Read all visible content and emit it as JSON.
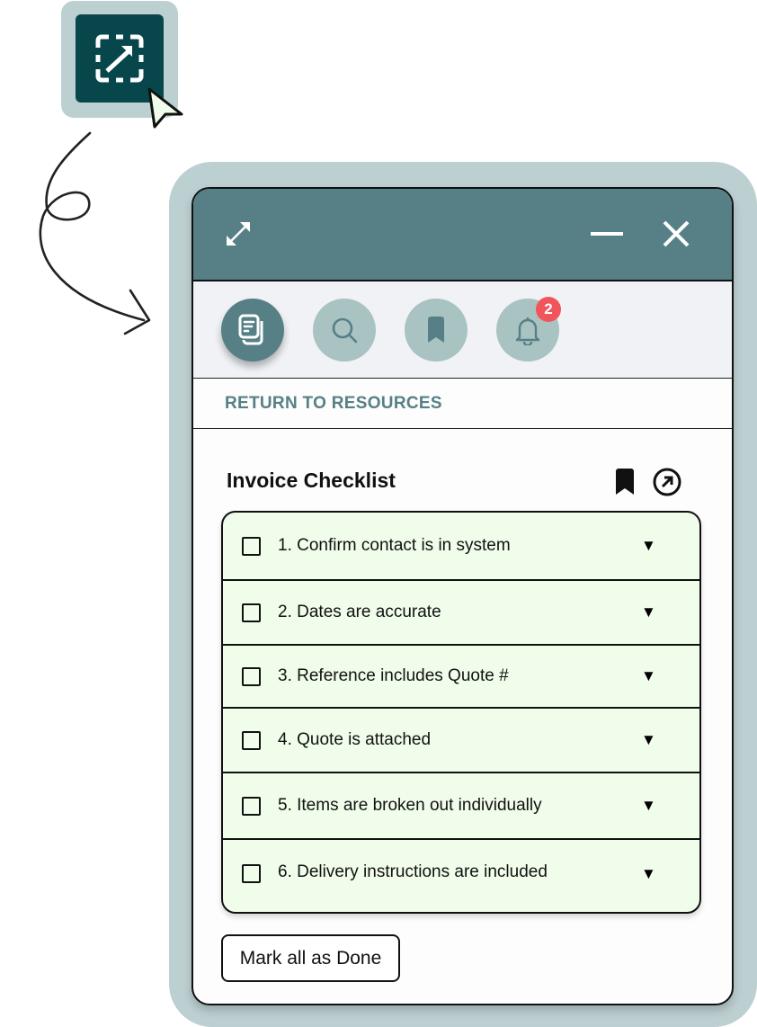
{
  "launcher": {
    "icon": "expand-selection-icon",
    "cursor": "pointer-cursor-icon"
  },
  "window": {
    "titlebar": {
      "expand_icon": "resize-diagonal-icon",
      "minimize_icon": "minimize-icon",
      "close_icon": "close-icon"
    },
    "toolbar": {
      "tools": [
        {
          "name": "documents",
          "icon": "documents-icon",
          "active": true
        },
        {
          "name": "search",
          "icon": "search-icon",
          "active": false
        },
        {
          "name": "bookmarks",
          "icon": "bookmark-icon",
          "active": false
        },
        {
          "name": "notifications",
          "icon": "bell-icon",
          "active": false,
          "badge": "2"
        }
      ]
    },
    "return_link": "RETURN TO RESOURCES",
    "checklist": {
      "title": "Invoice Checklist",
      "items": [
        {
          "label": "1. Confirm contact is in system",
          "checked": false
        },
        {
          "label": "2. Dates are accurate",
          "checked": false
        },
        {
          "label": "3. Reference includes Quote #",
          "checked": false
        },
        {
          "label": "4. Quote is attached",
          "checked": false
        },
        {
          "label": "5. Items are broken out individually",
          "checked": false
        },
        {
          "label": "6. Delivery instructions are included",
          "checked": false
        }
      ],
      "caret": "▼"
    },
    "mark_all_button": "Mark all as Done"
  },
  "colors": {
    "frame": "#bccfd1",
    "titlebar": "#568086",
    "launcher": "#07474c",
    "toolbar_bg": "#f1f2f6",
    "tool_inactive": "#a9c3c2",
    "checklist_bg": "#f0fdea",
    "badge": "#f1545a"
  }
}
